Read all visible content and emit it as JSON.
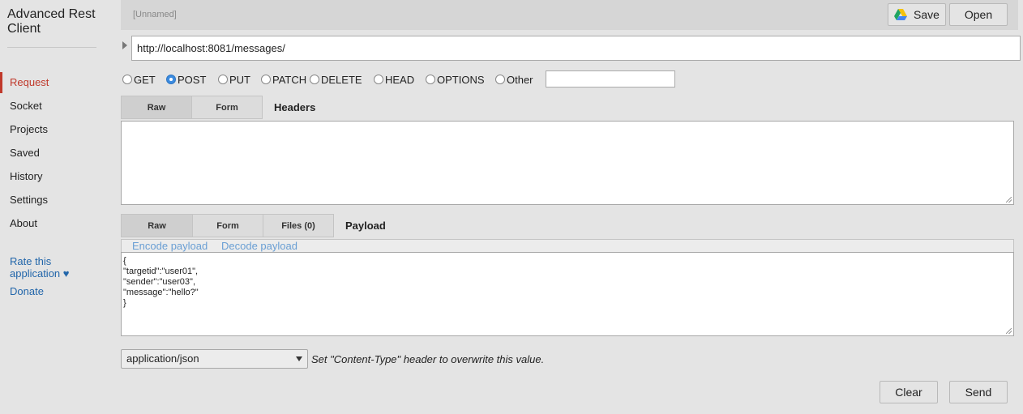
{
  "app": {
    "title": "Advanced Rest Client"
  },
  "sidebar": {
    "items": [
      {
        "label": "Request",
        "active": true
      },
      {
        "label": "Socket"
      },
      {
        "label": "Projects"
      },
      {
        "label": "Saved"
      },
      {
        "label": "History"
      },
      {
        "label": "Settings"
      },
      {
        "label": "About"
      }
    ],
    "rate_label": "Rate this application ♥",
    "donate_label": "Donate"
  },
  "topbar": {
    "request_name": "[Unnamed]",
    "save_label": "Save",
    "open_label": "Open",
    "save_icon": "google-drive-icon"
  },
  "url": {
    "value": "http://localhost:8081/messages/"
  },
  "methods": [
    {
      "label": "GET",
      "checked": false
    },
    {
      "label": "POST",
      "checked": true
    },
    {
      "label": "PUT",
      "checked": false
    },
    {
      "label": "PATCH",
      "checked": false
    },
    {
      "label": "DELETE",
      "checked": false
    },
    {
      "label": "HEAD",
      "checked": false
    },
    {
      "label": "OPTIONS",
      "checked": false
    },
    {
      "label": "Other",
      "checked": false
    }
  ],
  "headers": {
    "tabs": [
      "Raw",
      "Form"
    ],
    "active_tab": "Raw",
    "label": "Headers",
    "value": ""
  },
  "payload": {
    "tabs": [
      "Raw",
      "Form",
      "Files (0)"
    ],
    "active_tab": "Raw",
    "label": "Payload",
    "encode_label": "Encode payload",
    "decode_label": "Decode payload",
    "lines": [
      "{",
      "\"targetid\":\"user01\",",
      "\"sender\":\"user03\",",
      "\"message\":\"hello?\"",
      "}"
    ]
  },
  "content_type": {
    "selected": "application/json",
    "hint": "Set \"Content-Type\" header to overwrite this value."
  },
  "actions": {
    "clear_label": "Clear",
    "send_label": "Send"
  },
  "colors": {
    "accent": "#c0392b",
    "link": "#2266aa",
    "radio_checked": "#3b8be0"
  }
}
